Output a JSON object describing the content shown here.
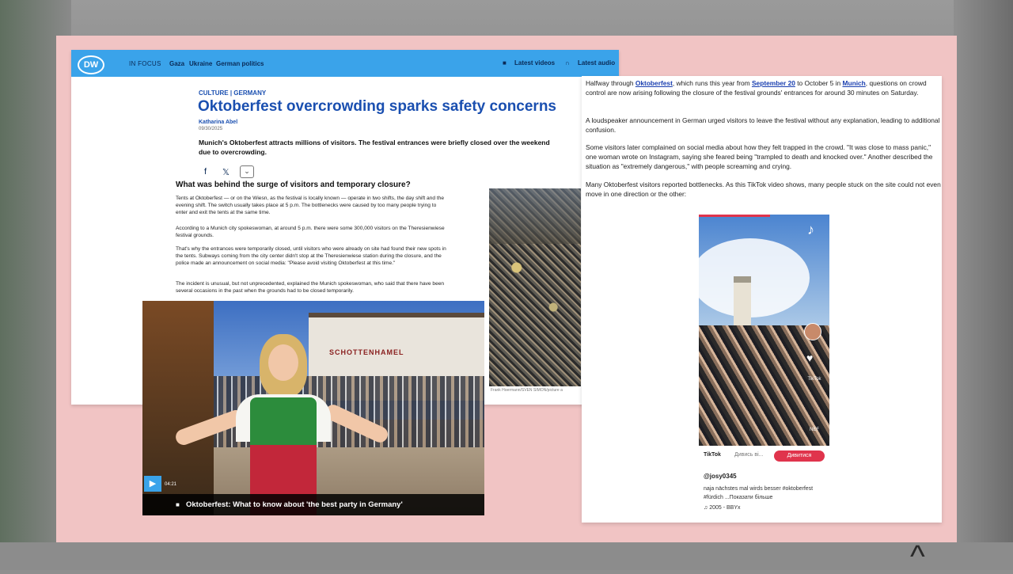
{
  "dw": {
    "logo": "DW",
    "nav": {
      "focus_label": "IN FOCUS",
      "links": [
        "Gaza",
        "Ukraine",
        "German politics"
      ]
    },
    "top_right": {
      "videos": "Latest videos",
      "audio": "Latest audio"
    },
    "kicker": "CULTURE | GERMANY",
    "headline": "Oktoberfest overcrowding sparks safety concerns",
    "author": "Katharina Abel",
    "date": "09/30/2025",
    "lead": "Munich's Oktoberfest attracts millions of visitors. The festival entrances were briefly closed over the weekend due to overcrowding.",
    "share_icons": [
      "f",
      "𝕏"
    ],
    "subheading": "What was behind the surge of visitors and temporary closure?",
    "paragraphs": [
      "Tents at Oktoberfest — or on the Wiesn, as the festival is locally known — operate in two shifts, the day shift and the evening shift. The switch usually takes place at 5 p.m. The bottlenecks were caused by too many people trying to enter and exit the tents at the same time.",
      "According to a Munich city spokeswoman, at around 5 p.m. there were some 300,000 visitors on the Theresienwiese festival grounds.",
      "That's why the entrances were temporarily closed, until visitors who were already on site had found their new spots in the tents. Subways coming from the city center didn't stop at the Theresienwiese station during the closure, and the police made an announcement on social media: \"Please avoid visiting Oktoberfest at this time.\"",
      "The incident is unusual, but not unprecedented, explained the Munich spokeswoman, who said that there have been several occasions in the past when the grounds had to be closed temporarily."
    ],
    "photo_credit": "Frank Hoermann/SVEN SIMON/picture a",
    "video": {
      "duration": "04:21",
      "caption": "Oktoberfest: What to know about 'the best party in Germany'",
      "sign_text": "SCHOTTENHAMEL"
    }
  },
  "right": {
    "p1": {
      "pre": "Halfway through ",
      "link1": "Oktoberfest",
      "mid1": ", which runs this year from ",
      "link2": "September 20",
      "mid2": " to October 5 in ",
      "link3": "Munich",
      "post": ", questions on crowd control are now arising following the closure of the festival grounds' entrances for around 30 minutes on Saturday."
    },
    "p2": "A loudspeaker announcement in German urged visitors to leave the festival without any explanation, leading to additional confusion.",
    "p3": "Some visitors later complained on social media about how they felt trapped in the crowd. \"It was close to mass panic,\" one woman wrote on Instagram, saying she feared being \"trampled to death and knocked over.\" Another described the situation as \"extremely dangerous,\" with people screaming and crying.",
    "p4": "Many Oktoberfest visitors reported bottlenecks. As this TikTok video shows, many people stuck on the site could not even move in one direction or the other:",
    "tiktok": {
      "brand": "TikTok",
      "watch": "Дивись ві...",
      "button": "Дивитися",
      "user": "@josy0345",
      "desc": "naja nächstes mal wirds besser #oktoberfest #fürdich ...Показати більше",
      "music": "♫ 2005 - BBYx",
      "side_labels": [
        "TikTok",
        "NEF"
      ]
    }
  },
  "colors": {
    "dw_blue": "#3aa3ea",
    "link_blue": "#1a3fb0",
    "stage_pink": "#f1c4c4",
    "tiktok_red": "#e0344c"
  }
}
